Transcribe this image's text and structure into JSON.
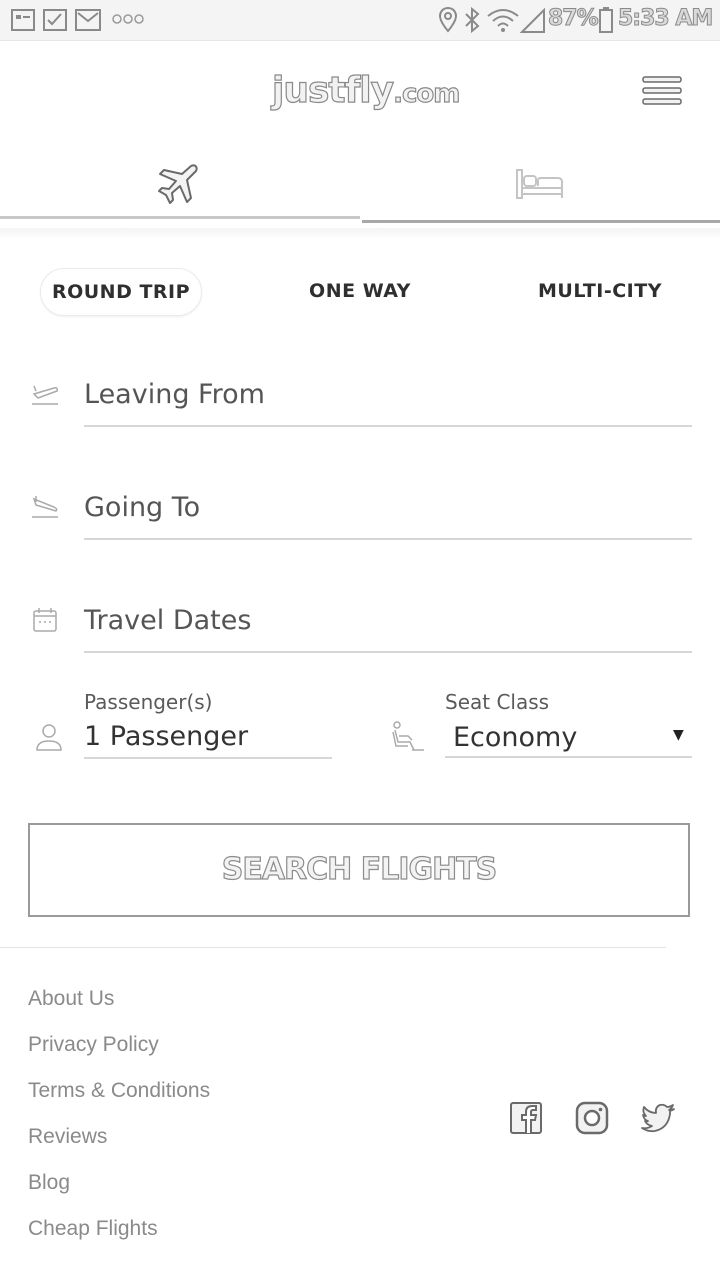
{
  "status_bar": {
    "battery": "87%",
    "time": "5:33 AM"
  },
  "header": {
    "logo_main": "justfly",
    "logo_suffix": ".com",
    "menu_icon": "hamburger-menu-icon"
  },
  "mode_tabs": [
    {
      "icon": "airplane-icon",
      "selected": true
    },
    {
      "icon": "bed-icon",
      "selected": false
    }
  ],
  "trip_types": [
    {
      "label": "ROUND TRIP",
      "selected": true
    },
    {
      "label": "ONE WAY",
      "selected": false
    },
    {
      "label": "MULTI-CITY",
      "selected": false
    }
  ],
  "form": {
    "leaving_from": "Leaving From",
    "going_to": "Going To",
    "travel_dates": "Travel Dates",
    "passengers_label": "Passenger(s)",
    "passengers_value": "1 Passenger",
    "seat_class_label": "Seat Class",
    "seat_class_value": "Economy",
    "search_button": "SEARCH FLIGHTS"
  },
  "footer": {
    "links": [
      "About Us",
      "Privacy Policy",
      "Terms & Conditions",
      "Reviews",
      "Blog",
      "Cheap Flights"
    ],
    "social": [
      "facebook-icon",
      "instagram-icon",
      "twitter-icon"
    ]
  },
  "colors": {
    "text": "#333333",
    "muted": "#8a8a8a",
    "border": "#d6d6d6"
  }
}
